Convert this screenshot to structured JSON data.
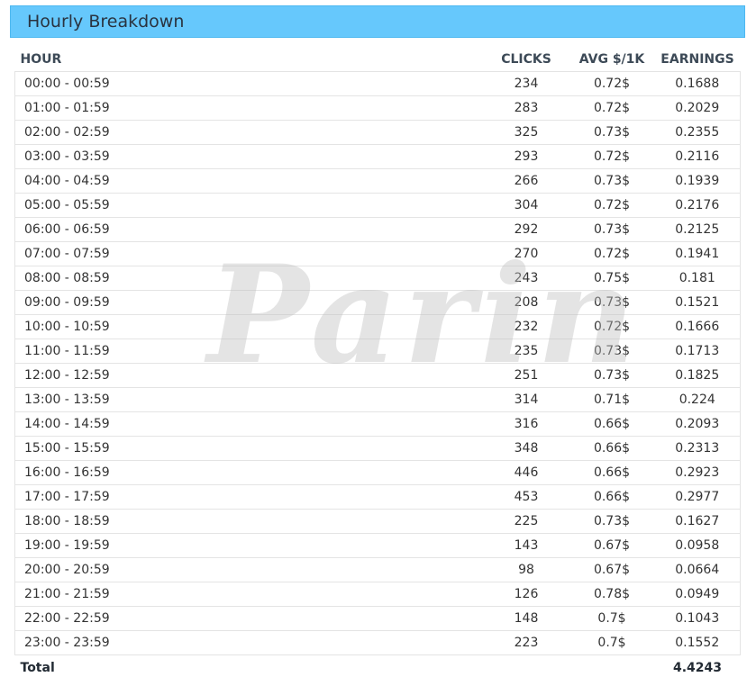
{
  "panel": {
    "title": "Hourly Breakdown"
  },
  "table": {
    "headers": {
      "hour": "HOUR",
      "clicks": "CLICKS",
      "avg": "AVG $/1K",
      "earnings": "EARNINGS"
    },
    "rows": [
      {
        "hour": "00:00 - 00:59",
        "clicks": "234",
        "avg": "0.72$",
        "earnings": "0.1688"
      },
      {
        "hour": "01:00 - 01:59",
        "clicks": "283",
        "avg": "0.72$",
        "earnings": "0.2029"
      },
      {
        "hour": "02:00 - 02:59",
        "clicks": "325",
        "avg": "0.73$",
        "earnings": "0.2355"
      },
      {
        "hour": "03:00 - 03:59",
        "clicks": "293",
        "avg": "0.72$",
        "earnings": "0.2116"
      },
      {
        "hour": "04:00 - 04:59",
        "clicks": "266",
        "avg": "0.73$",
        "earnings": "0.1939"
      },
      {
        "hour": "05:00 - 05:59",
        "clicks": "304",
        "avg": "0.72$",
        "earnings": "0.2176"
      },
      {
        "hour": "06:00 - 06:59",
        "clicks": "292",
        "avg": "0.73$",
        "earnings": "0.2125"
      },
      {
        "hour": "07:00 - 07:59",
        "clicks": "270",
        "avg": "0.72$",
        "earnings": "0.1941"
      },
      {
        "hour": "08:00 - 08:59",
        "clicks": "243",
        "avg": "0.75$",
        "earnings": "0.181"
      },
      {
        "hour": "09:00 - 09:59",
        "clicks": "208",
        "avg": "0.73$",
        "earnings": "0.1521"
      },
      {
        "hour": "10:00 - 10:59",
        "clicks": "232",
        "avg": "0.72$",
        "earnings": "0.1666"
      },
      {
        "hour": "11:00 - 11:59",
        "clicks": "235",
        "avg": "0.73$",
        "earnings": "0.1713"
      },
      {
        "hour": "12:00 - 12:59",
        "clicks": "251",
        "avg": "0.73$",
        "earnings": "0.1825"
      },
      {
        "hour": "13:00 - 13:59",
        "clicks": "314",
        "avg": "0.71$",
        "earnings": "0.224"
      },
      {
        "hour": "14:00 - 14:59",
        "clicks": "316",
        "avg": "0.66$",
        "earnings": "0.2093"
      },
      {
        "hour": "15:00 - 15:59",
        "clicks": "348",
        "avg": "0.66$",
        "earnings": "0.2313"
      },
      {
        "hour": "16:00 - 16:59",
        "clicks": "446",
        "avg": "0.66$",
        "earnings": "0.2923"
      },
      {
        "hour": "17:00 - 17:59",
        "clicks": "453",
        "avg": "0.66$",
        "earnings": "0.2977"
      },
      {
        "hour": "18:00 - 18:59",
        "clicks": "225",
        "avg": "0.73$",
        "earnings": "0.1627"
      },
      {
        "hour": "19:00 - 19:59",
        "clicks": "143",
        "avg": "0.67$",
        "earnings": "0.0958"
      },
      {
        "hour": "20:00 - 20:59",
        "clicks": "98",
        "avg": "0.67$",
        "earnings": "0.0664"
      },
      {
        "hour": "21:00 - 21:59",
        "clicks": "126",
        "avg": "0.78$",
        "earnings": "0.0949"
      },
      {
        "hour": "22:00 - 22:59",
        "clicks": "148",
        "avg": "0.7$",
        "earnings": "0.1043"
      },
      {
        "hour": "23:00 - 23:59",
        "clicks": "223",
        "avg": "0.7$",
        "earnings": "0.1552"
      }
    ],
    "footer": {
      "label": "Total",
      "earnings": "4.4243"
    }
  },
  "watermark": {
    "text": "Parin"
  }
}
